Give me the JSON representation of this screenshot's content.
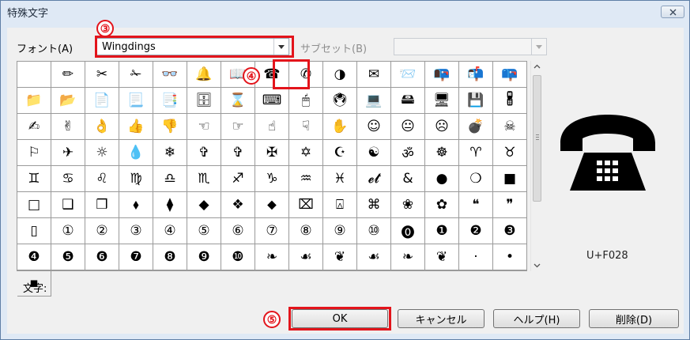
{
  "window": {
    "title": "特殊文字"
  },
  "font_row": {
    "font_label": "フォント(A)",
    "font_value": "Wingdings",
    "subset_label": "サブセット(B)",
    "subset_value": ""
  },
  "grid": {
    "selected_index": 7,
    "cells": [
      "",
      "✏",
      "✂",
      "✁",
      "👓",
      "🔔",
      "📖",
      "☎",
      "✆",
      "◑",
      "✉",
      "📨",
      "📭",
      "📬",
      "📪",
      "📁",
      "📂",
      "📄",
      "📃",
      "📑",
      "🗄",
      "⌛",
      "⌨",
      "🖱",
      "🖲",
      "💻",
      "🖴",
      "🖥",
      "💾",
      "🖁",
      "✍",
      "✌",
      "👌",
      "👍",
      "👎",
      "☜",
      "☞",
      "☝",
      "☟",
      "✋",
      "☺",
      "😐",
      "☹",
      "💣",
      "☠",
      "⚐",
      "✈",
      "☼",
      "💧",
      "❄",
      "✞",
      "✞",
      "✠",
      "✡",
      "☪",
      "☯",
      "ॐ",
      "☸",
      "♈",
      "♉",
      "♊",
      "♋",
      "♌",
      "♍",
      "♎",
      "♏",
      "♐",
      "♑",
      "♒",
      "♓",
      "𝓮𝓽",
      "&",
      "●",
      "❍",
      "■",
      "□",
      "❑",
      "❒",
      "⬧",
      "⧫",
      "◆",
      "❖",
      "⬥",
      "⌧",
      "⍓",
      "⌘",
      "❀",
      "✿",
      "❝",
      "❞",
      "▯",
      "①",
      "②",
      "③",
      "④",
      "⑤",
      "⑥",
      "⑦",
      "⑧",
      "⑨",
      "⑩",
      "⓿",
      "❶",
      "❷",
      "❸",
      "❹",
      "❺",
      "❻",
      "❼",
      "❽",
      "❾",
      "❿",
      "❧",
      "☙",
      "❦",
      "☙",
      "❧",
      "❦",
      "·",
      "•"
    ],
    "last_cell": "▪"
  },
  "preview": {
    "unicode": "U+F028"
  },
  "char_label": "文字:",
  "buttons": {
    "ok": "OK",
    "cancel": "キャンセル",
    "help": "ヘルプ(H)",
    "delete": "削除(D)"
  },
  "annotations": {
    "three": "③",
    "four": "④",
    "five": "⑤"
  },
  "colors": {
    "annotation": "#e3141b",
    "titlebar": "#dfe9f5"
  }
}
